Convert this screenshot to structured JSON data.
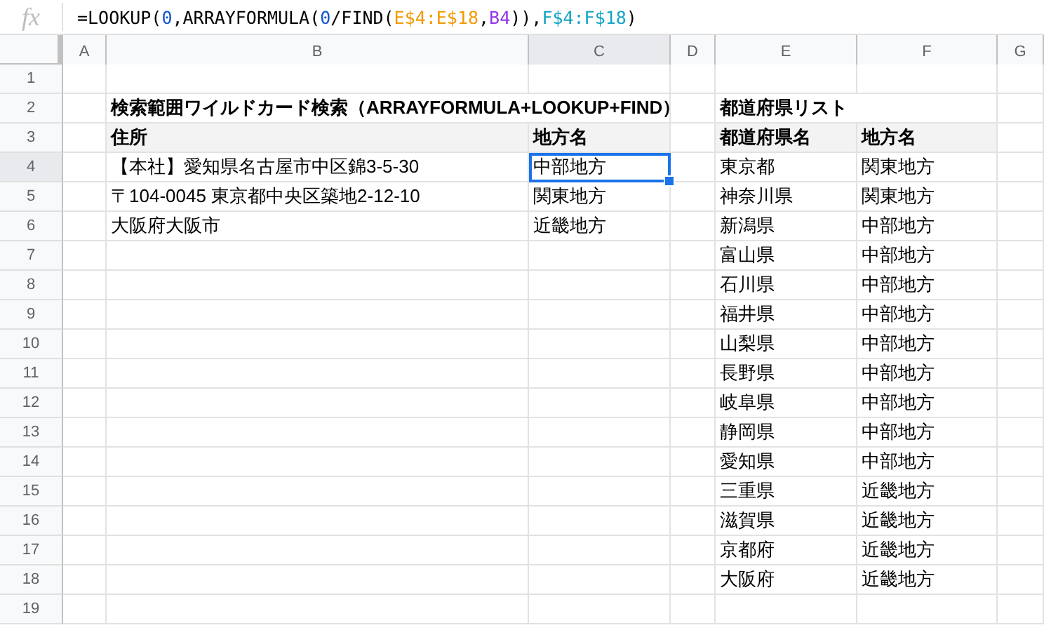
{
  "formula_bar": {
    "icon_label": "fx",
    "formula": [
      {
        "text": "=LOOKUP(",
        "color": "#000000"
      },
      {
        "text": "0",
        "color": "#1155cc"
      },
      {
        "text": ",ARRAYFORMULA(",
        "color": "#000000"
      },
      {
        "text": "0",
        "color": "#1155cc"
      },
      {
        "text": "/FIND(",
        "color": "#000000"
      },
      {
        "text": "E$4:E$18",
        "color": "#f29900"
      },
      {
        "text": ",",
        "color": "#000000"
      },
      {
        "text": "B4",
        "color": "#9334e6"
      },
      {
        "text": ")),",
        "color": "#000000"
      },
      {
        "text": "F$4:F$18",
        "color": "#12a4c4"
      },
      {
        "text": ")",
        "color": "#000000"
      }
    ]
  },
  "columns": [
    {
      "label": "A",
      "selected": false
    },
    {
      "label": "B",
      "selected": false
    },
    {
      "label": "C",
      "selected": true
    },
    {
      "label": "D",
      "selected": false
    },
    {
      "label": "E",
      "selected": false
    },
    {
      "label": "F",
      "selected": false
    },
    {
      "label": "G",
      "selected": false
    }
  ],
  "row_numbers": [
    {
      "label": "1",
      "selected": false
    },
    {
      "label": "2",
      "selected": false
    },
    {
      "label": "3",
      "selected": false
    },
    {
      "label": "4",
      "selected": true
    },
    {
      "label": "5",
      "selected": false
    },
    {
      "label": "6",
      "selected": false
    },
    {
      "label": "7",
      "selected": false
    },
    {
      "label": "8",
      "selected": false
    },
    {
      "label": "9",
      "selected": false
    },
    {
      "label": "10",
      "selected": false
    },
    {
      "label": "11",
      "selected": false
    },
    {
      "label": "12",
      "selected": false
    },
    {
      "label": "13",
      "selected": false
    },
    {
      "label": "14",
      "selected": false
    },
    {
      "label": "15",
      "selected": false
    },
    {
      "label": "16",
      "selected": false
    },
    {
      "label": "17",
      "selected": false
    },
    {
      "label": "18",
      "selected": false
    },
    {
      "label": "19",
      "selected": false
    }
  ],
  "search_table": {
    "title": "検索範囲ワイルドカード検索（ARRAYFORMULA+LOOKUP+FIND）",
    "headers": [
      "住所",
      "地方名"
    ],
    "rows": [
      {
        "address": "【本社】愛知県名古屋市中区錦3-5-30",
        "region": "中部地方",
        "selected": true
      },
      {
        "address": "〒104-0045 東京都中央区築地2-12-10",
        "region": "関東地方",
        "selected": false
      },
      {
        "address": "大阪府大阪市",
        "region": "近畿地方",
        "selected": false
      }
    ]
  },
  "prefecture_list": {
    "title": "都道府県リスト",
    "headers": [
      "都道府県名",
      "地方名"
    ],
    "rows": [
      {
        "prefecture": "東京都",
        "region": "関東地方"
      },
      {
        "prefecture": "神奈川県",
        "region": "関東地方"
      },
      {
        "prefecture": "新潟県",
        "region": "中部地方"
      },
      {
        "prefecture": "富山県",
        "region": "中部地方"
      },
      {
        "prefecture": "石川県",
        "region": "中部地方"
      },
      {
        "prefecture": "福井県",
        "region": "中部地方"
      },
      {
        "prefecture": "山梨県",
        "region": "中部地方"
      },
      {
        "prefecture": "長野県",
        "region": "中部地方"
      },
      {
        "prefecture": "岐阜県",
        "region": "中部地方"
      },
      {
        "prefecture": "静岡県",
        "region": "中部地方"
      },
      {
        "prefecture": "愛知県",
        "region": "中部地方"
      },
      {
        "prefecture": "三重県",
        "region": "近畿地方"
      },
      {
        "prefecture": "滋賀県",
        "region": "近畿地方"
      },
      {
        "prefecture": "京都府",
        "region": "近畿地方"
      },
      {
        "prefecture": "大阪府",
        "region": "近畿地方"
      }
    ]
  }
}
